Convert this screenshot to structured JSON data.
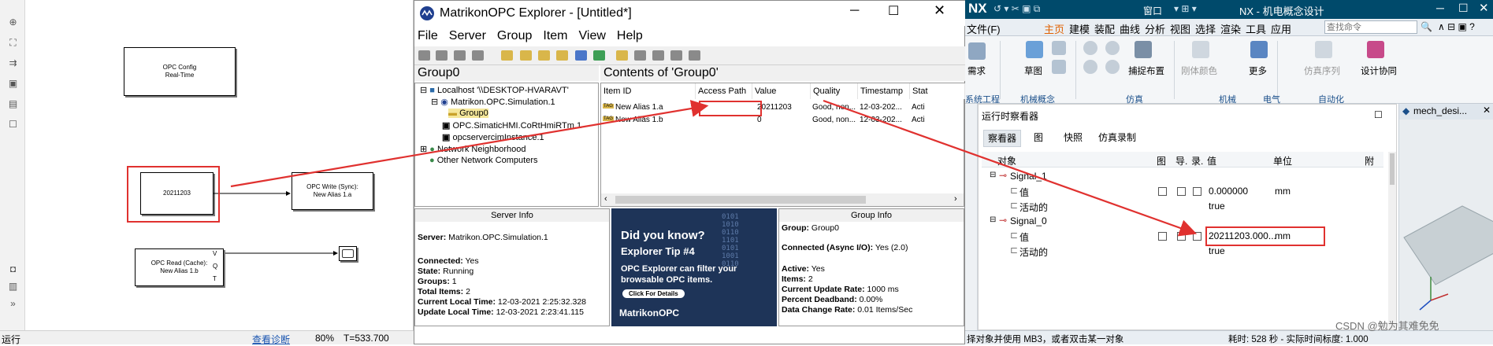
{
  "simulink": {
    "toolbar_icons": [
      "zoom-in-icon",
      "fit-view-icon",
      "arrow-icon",
      "image-icon",
      "camera-icon",
      "checkbox-icon"
    ],
    "blocks": {
      "opc_config": "OPC Config\nReal-Time",
      "constant": "20211203",
      "opc_write": "OPC Write (Sync):\nNew Alias 1.a",
      "opc_read": "OPC Read (Cache):\nNew Alias 1.b",
      "read_ports": [
        "V",
        "Q",
        "T"
      ]
    },
    "status": {
      "left": "运行",
      "diagnostics": "查看诊断",
      "zoom": "80%",
      "time": "T=533.700"
    }
  },
  "matrikon": {
    "title": "MatrikonOPC Explorer - [Untitled*]",
    "menu": [
      "File",
      "Server",
      "Group",
      "Item",
      "View",
      "Help"
    ],
    "tree_header": "Group0",
    "tree": [
      {
        "label": "Localhost '\\\\DESKTOP-HVARAVT'",
        "level": 0
      },
      {
        "label": "Matrikon.OPC.Simulation.1",
        "level": 1
      },
      {
        "label": "Group0",
        "level": 2
      },
      {
        "label": "OPC.SimaticHMI.CoRtHmiRTm.1",
        "level": 1
      },
      {
        "label": "opcservercimInstance.1",
        "level": 1
      },
      {
        "label": "Network Neighborhood",
        "level": 0
      },
      {
        "label": "Other Network Computers",
        "level": 0
      }
    ],
    "contents_header": "Contents of 'Group0'",
    "columns": [
      "Item ID",
      "Access Path",
      "Value",
      "Quality",
      "Timestamp",
      "Stat"
    ],
    "rows": [
      {
        "item": "New Alias 1.a",
        "path": "",
        "value": "20211203",
        "quality": "Good, non...",
        "timestamp": "12-03-202...",
        "status": "Acti"
      },
      {
        "item": "New Alias 1.b",
        "path": "",
        "value": "0",
        "quality": "Good, non...",
        "timestamp": "12-03-202...",
        "status": "Acti"
      }
    ],
    "server_info": {
      "title": "Server Info",
      "server": "Matrikon.OPC.Simulation.1",
      "connected": "Yes",
      "state": "Running",
      "groups": "1",
      "total_items": "2",
      "local_time": "12-03-2021 2:25:32.328",
      "update_time": "12-03-2021 2:23:41.115",
      "labels": {
        "server": "Server:",
        "connected": "Connected:",
        "state": "State:",
        "groups": "Groups:",
        "total_items": "Total Items:",
        "local_time": "Current Local Time:",
        "update_time": "Update Local Time:"
      }
    },
    "tip": {
      "line1": "Did you know?",
      "line2": "Explorer Tip #4",
      "line3": "OPC Explorer can filter your",
      "line4": "browsable OPC items.",
      "button": "Click For Details",
      "brand": "MatrikonOPC"
    },
    "group_info": {
      "title": "Group Info",
      "group": "Group0",
      "connected": "Yes (2.0)",
      "active": "Yes",
      "items": "2",
      "rate": "1000 ms",
      "deadband": "0.00%",
      "change_rate": "0.01 Items/Sec",
      "labels": {
        "group": "Group:",
        "connected": "Connected (Async I/O):",
        "active": "Active:",
        "items": "Items:",
        "rate": "Current Update Rate:",
        "deadband": "Percent Deadband:",
        "change_rate": "Data Change Rate:"
      }
    }
  },
  "nx": {
    "logo": "NX",
    "title": "NX - 机电概念设计",
    "window_menu": "窗口",
    "search_placeholder": "查找命令",
    "menu": [
      "文件(F)",
      "主页",
      "建模",
      "装配",
      "曲线",
      "分析",
      "视图",
      "选择",
      "渲染",
      "工具",
      "应用"
    ],
    "ribbon_labels": [
      "需求",
      "草图",
      "刚体颜色",
      "更多",
      "捕捉布置",
      "仿真序列",
      "设计协同"
    ],
    "group_labels": [
      "系统工程",
      "机械概念",
      "仿真",
      "机械",
      "电气",
      "自动化"
    ],
    "panel_title": "运行时察看器",
    "tabs": [
      "察看器",
      "图",
      "快照",
      "仿真录制"
    ],
    "columns": [
      "对象",
      "图",
      "导.",
      "录.",
      "值",
      "单位",
      "附"
    ],
    "rows": [
      {
        "name": "Signal_1",
        "indent": 0,
        "value": "",
        "unit": ""
      },
      {
        "name": "值",
        "indent": 1,
        "value": "0.000000",
        "unit": "mm"
      },
      {
        "name": "活动的",
        "indent": 1,
        "value": "true",
        "unit": ""
      },
      {
        "name": "Signal_0",
        "indent": 0,
        "value": "",
        "unit": ""
      },
      {
        "name": "值",
        "indent": 1,
        "value": "20211203.000...",
        "unit": "mm"
      },
      {
        "name": "活动的",
        "indent": 1,
        "value": "true",
        "unit": ""
      }
    ],
    "view_tab": "mech_desi...",
    "status_left": "择对象并使用 MB3，或者双击某一对象",
    "status_right": "耗时: 528 秒 - 实际时间标度: 1.000",
    "watermark": "CSDN @勉为其难免免"
  }
}
